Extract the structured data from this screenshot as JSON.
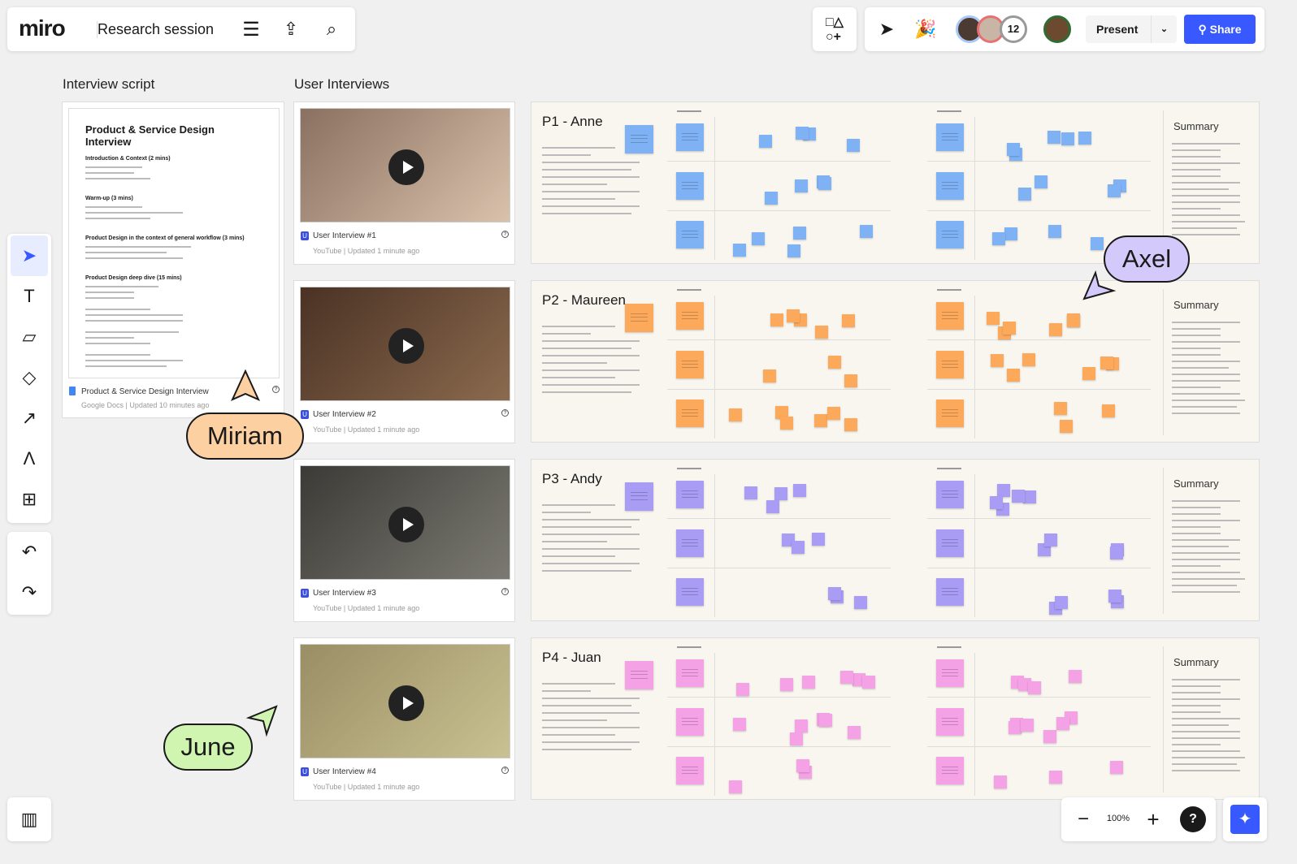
{
  "header": {
    "logo": "miro",
    "board_name": "Research session",
    "present_label": "Present",
    "share_label": "Share",
    "collaborator_count": "12"
  },
  "sections": {
    "script": "Interview script",
    "interviews": "User Interviews"
  },
  "doc": {
    "title": "Product & Service Design Interview",
    "headings": [
      "Introduction & Context (2 mins)",
      "Warm-up (3 mins)",
      "Product Design in the context of general workflow (3 mins)",
      "Product Design deep dive (15 mins)"
    ],
    "card_title": "Product & Service Design Interview",
    "source": "Google Docs",
    "updated": "Updated 10 minutes ago"
  },
  "videos": [
    {
      "title": "User Interview #1",
      "source": "YouTube",
      "updated": "Updated 1 minute ago"
    },
    {
      "title": "User Interview #2",
      "source": "YouTube",
      "updated": "Updated 1 minute ago"
    },
    {
      "title": "User Interview #3",
      "source": "YouTube",
      "updated": "Updated 1 minute ago"
    },
    {
      "title": "User Interview #4",
      "source": "YouTube",
      "updated": "Updated 1 minute ago"
    }
  ],
  "boards": [
    {
      "title": "P1 - Anne",
      "summary": "Summary",
      "color": "#7fb2f5"
    },
    {
      "title": "P2 - Maureen",
      "summary": "Summary",
      "color": "#fca95c"
    },
    {
      "title": "P3 - Andy",
      "summary": "Summary",
      "color": "#a99cf5"
    },
    {
      "title": "P4 - Juan",
      "summary": "Summary",
      "color": "#f5a1e6"
    }
  ],
  "cursors": [
    {
      "name": "Miriam",
      "color": "#fdd0a2"
    },
    {
      "name": "Axel",
      "color": "#d3c9fb"
    },
    {
      "name": "June",
      "color": "#cff5b0"
    }
  ],
  "zoom": {
    "level": "100%"
  },
  "colors": {
    "accent": "#3859ff"
  }
}
